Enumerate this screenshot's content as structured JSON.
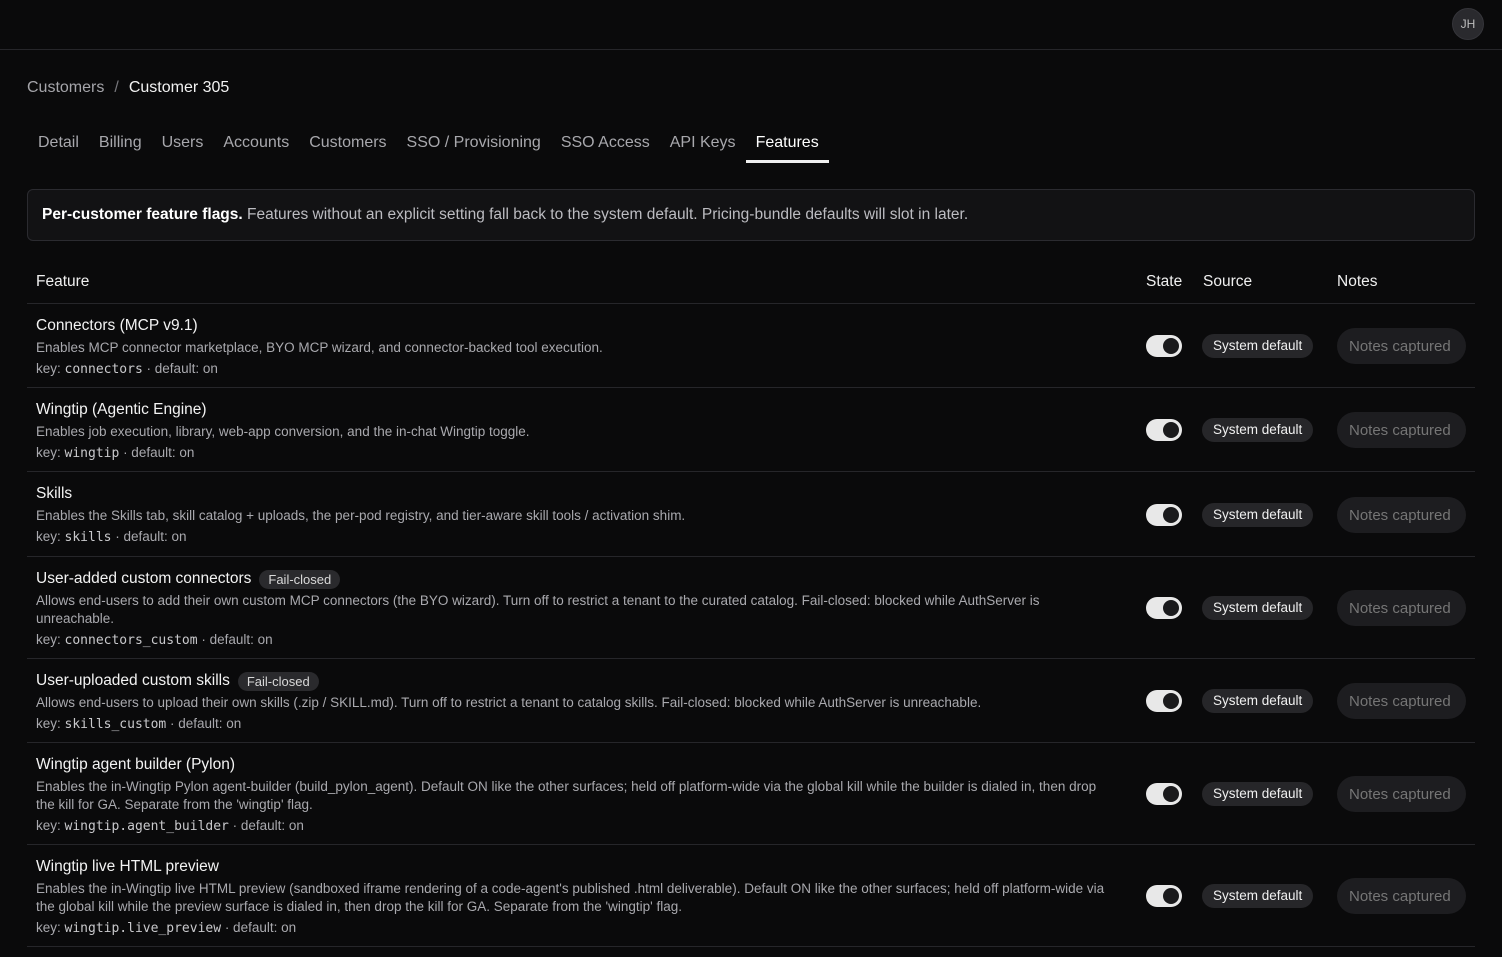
{
  "header": {
    "avatar_initials": "JH"
  },
  "breadcrumb": {
    "parent": "Customers",
    "separator": "/",
    "current": "Customer 305"
  },
  "tabs": [
    "Detail",
    "Billing",
    "Users",
    "Accounts",
    "Customers",
    "SSO / Provisioning",
    "SSO Access",
    "API Keys",
    "Features"
  ],
  "active_tab": "Features",
  "banner": {
    "bold": "Per-customer feature flags.",
    "text": " Features without an explicit setting fall back to the system default. Pricing-bundle defaults will slot in later."
  },
  "table": {
    "headers": {
      "feature": "Feature",
      "state": "State",
      "source": "Source",
      "notes": "Notes"
    }
  },
  "features": [
    {
      "name": "Connectors (MCP v9.1)",
      "badge": "",
      "desc": "Enables MCP connector marketplace, BYO MCP wizard, and connector-backed tool execution.",
      "key": "connectors",
      "default": " · default: on",
      "state": true,
      "source": "System default",
      "notes_placeholder": "Notes captured"
    },
    {
      "name": "Wingtip (Agentic Engine)",
      "badge": "",
      "desc": "Enables job execution, library, web-app conversion, and the in-chat Wingtip toggle.",
      "key": "wingtip",
      "default": " · default: on",
      "state": true,
      "source": "System default",
      "notes_placeholder": "Notes captured"
    },
    {
      "name": "Skills",
      "badge": "",
      "desc": "Enables the Skills tab, skill catalog + uploads, the per-pod registry, and tier-aware skill tools / activation shim.",
      "key": "skills",
      "default": " · default: on",
      "state": true,
      "source": "System default",
      "notes_placeholder": "Notes captured"
    },
    {
      "name": "User-added custom connectors",
      "badge": "Fail-closed",
      "desc": "Allows end-users to add their own custom MCP connectors (the BYO wizard). Turn off to restrict a tenant to the curated catalog. Fail-closed: blocked while AuthServer is unreachable.",
      "key": "connectors_custom",
      "default": " · default: on",
      "state": true,
      "source": "System default",
      "notes_placeholder": "Notes captured"
    },
    {
      "name": "User-uploaded custom skills",
      "badge": "Fail-closed",
      "desc": "Allows end-users to upload their own skills (.zip / SKILL.md). Turn off to restrict a tenant to catalog skills. Fail-closed: blocked while AuthServer is unreachable.",
      "key": "skills_custom",
      "default": " · default: on",
      "state": true,
      "source": "System default",
      "notes_placeholder": "Notes captured"
    },
    {
      "name": "Wingtip agent builder (Pylon)",
      "badge": "",
      "desc": "Enables the in-Wingtip Pylon agent-builder (build_pylon_agent). Default ON like the other surfaces; held off platform-wide via the global kill while the builder is dialed in, then drop the kill for GA. Separate from the 'wingtip' flag.",
      "key": "wingtip.agent_builder",
      "default": " · default: on",
      "state": true,
      "source": "System default",
      "notes_placeholder": "Notes captured"
    },
    {
      "name": "Wingtip live HTML preview",
      "badge": "",
      "desc": "Enables the in-Wingtip live HTML preview (sandboxed iframe rendering of a code-agent's published .html deliverable). Default ON like the other surfaces; held off platform-wide via the global kill while the preview surface is dialed in, then drop the kill for GA. Separate from the 'wingtip' flag.",
      "key": "wingtip.live_preview",
      "default": " · default: on",
      "state": true,
      "source": "System default",
      "notes_placeholder": "Notes captured"
    }
  ]
}
